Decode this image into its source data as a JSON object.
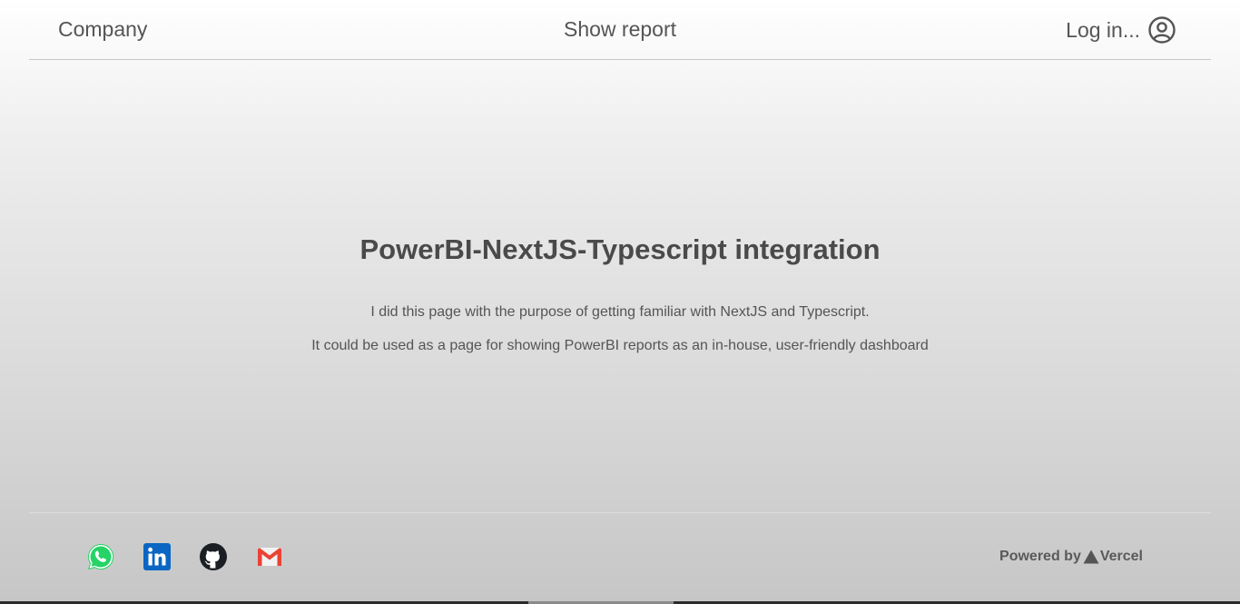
{
  "header": {
    "company_label": "Company",
    "show_report_label": "Show report",
    "login_label": "Log in...",
    "login_icon": "user-circle-icon"
  },
  "main": {
    "title": "PowerBI-NextJS-Typescript integration",
    "paragraph1": "I did this page with the purpose of getting familiar with NextJS and Typescript.",
    "paragraph2": "It could be used as a page for showing PowerBI reports as an in-house, user-friendly dashboard"
  },
  "footer": {
    "socials": [
      {
        "name": "whatsapp-icon",
        "color": "#25D366"
      },
      {
        "name": "linkedin-icon",
        "color": "#0A66C2"
      },
      {
        "name": "github-icon",
        "color": "#1b1f23"
      },
      {
        "name": "gmail-icon",
        "color": "#EA4335"
      }
    ],
    "powered_by_label": "Powered by",
    "vercel_label": "Vercel"
  },
  "colors": {
    "text": "#555555",
    "divider": "#c8c8c8"
  }
}
